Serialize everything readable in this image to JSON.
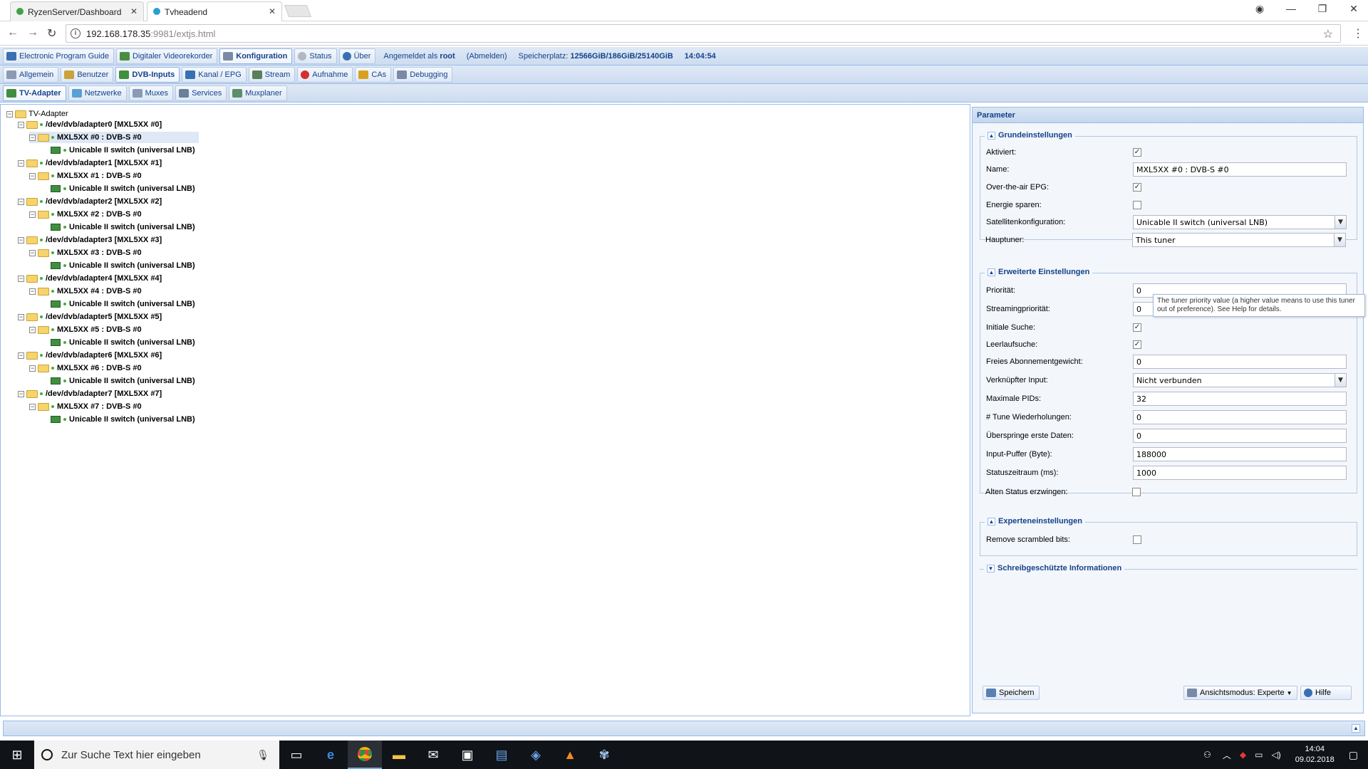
{
  "browser": {
    "tabs": [
      {
        "title": "RyzenServer/Dashboard",
        "favicon_color": "#43a047"
      },
      {
        "title": "Tvheadend",
        "favicon_color": "#2a9fd6"
      }
    ],
    "url_host": "192.168.178.35",
    "url_rest": ":9981/extjs.html"
  },
  "app": {
    "top_tabs": [
      "Electronic Program Guide",
      "Digitaler Videorekorder",
      "Konfiguration",
      "Status",
      "Über"
    ],
    "login_prefix": "Angemeldet als",
    "login_user": "root",
    "logout": "(Abmelden)",
    "storage_label": "Speicherplatz:",
    "storage_value": "12566GiB/186GiB/25140GiB",
    "time": "14:04:54",
    "config_tabs": [
      "Allgemein",
      "Benutzer",
      "DVB-Inputs",
      "Kanal / EPG",
      "Stream",
      "Aufnahme",
      "CAs",
      "Debugging"
    ],
    "dvb_tabs": [
      "TV-Adapter",
      "Netzwerke",
      "Muxes",
      "Services",
      "Muxplaner"
    ]
  },
  "tree": {
    "root": "TV-Adapter",
    "adapters": [
      {
        "device": "/dev/dvb/adapter0 [MXL5XX #0]",
        "frontend": "MXL5XX #0 : DVB-S #0",
        "satconf": "Unicable II switch (universal LNB)"
      },
      {
        "device": "/dev/dvb/adapter1 [MXL5XX #1]",
        "frontend": "MXL5XX #1 : DVB-S #0",
        "satconf": "Unicable II switch (universal LNB)"
      },
      {
        "device": "/dev/dvb/adapter2 [MXL5XX #2]",
        "frontend": "MXL5XX #2 : DVB-S #0",
        "satconf": "Unicable II switch (universal LNB)"
      },
      {
        "device": "/dev/dvb/adapter3 [MXL5XX #3]",
        "frontend": "MXL5XX #3 : DVB-S #0",
        "satconf": "Unicable II switch (universal LNB)"
      },
      {
        "device": "/dev/dvb/adapter4 [MXL5XX #4]",
        "frontend": "MXL5XX #4 : DVB-S #0",
        "satconf": "Unicable II switch (universal LNB)"
      },
      {
        "device": "/dev/dvb/adapter5 [MXL5XX #5]",
        "frontend": "MXL5XX #5 : DVB-S #0",
        "satconf": "Unicable II switch (universal LNB)"
      },
      {
        "device": "/dev/dvb/adapter6 [MXL5XX #6]",
        "frontend": "MXL5XX #6 : DVB-S #0",
        "satconf": "Unicable II switch (universal LNB)"
      },
      {
        "device": "/dev/dvb/adapter7 [MXL5XX #7]",
        "frontend": "MXL5XX #7 : DVB-S #0",
        "satconf": "Unicable II switch (universal LNB)"
      }
    ]
  },
  "params": {
    "title": "Parameter",
    "sections": {
      "basic": "Grundeinstellungen",
      "advanced": "Erweiterte Einstellungen",
      "expert": "Experteneinstellungen",
      "readonly": "Schreibgeschützte Informationen"
    },
    "basic": {
      "enabled_label": "Aktiviert:",
      "name_label": "Name:",
      "name_value": "MXL5XX #0 : DVB-S #0",
      "epg_label": "Over-the-air EPG:",
      "power_label": "Energie sparen:",
      "satconf_label": "Satellitenkonfiguration:",
      "satconf_value": "Unicable II switch (universal LNB)",
      "master_label": "Hauptuner:",
      "master_value": "This tuner"
    },
    "advanced": {
      "priority_label": "Priorität:",
      "priority_value": "0",
      "spriority_label": "Streamingpriorität:",
      "spriority_value": "0",
      "initscan_label": "Initiale Suche:",
      "idlescan_label": "Leerlaufsuche:",
      "freesub_label": "Freies Abonnementgewicht:",
      "freesub_value": "0",
      "linked_label": "Verknüpfter Input:",
      "linked_value": "Nicht verbunden",
      "maxpids_label": "Maximale PIDs:",
      "maxpids_value": "32",
      "retune_label": "# Tune Wiederholungen:",
      "retune_value": "0",
      "skip_label": "Überspringe erste Daten:",
      "skip_value": "0",
      "buffer_label": "Input-Puffer (Byte):",
      "buffer_value": "188000",
      "status_label": "Statuszeitraum (ms):",
      "status_value": "1000",
      "oldstatus_label": "Alten Status erzwingen:"
    },
    "expert": {
      "scrambled_label": "Remove scrambled bits:"
    },
    "tooltip": "The tuner priority value (a higher value means to use this tuner out of preference). See Help for details.",
    "save": "Speichern",
    "viewmode": "Ansichtsmodus: Experte",
    "help": "Hilfe"
  },
  "taskbar": {
    "search_placeholder": "Zur Suche Text hier eingeben",
    "time": "14:04",
    "date": "09.02.2018"
  }
}
